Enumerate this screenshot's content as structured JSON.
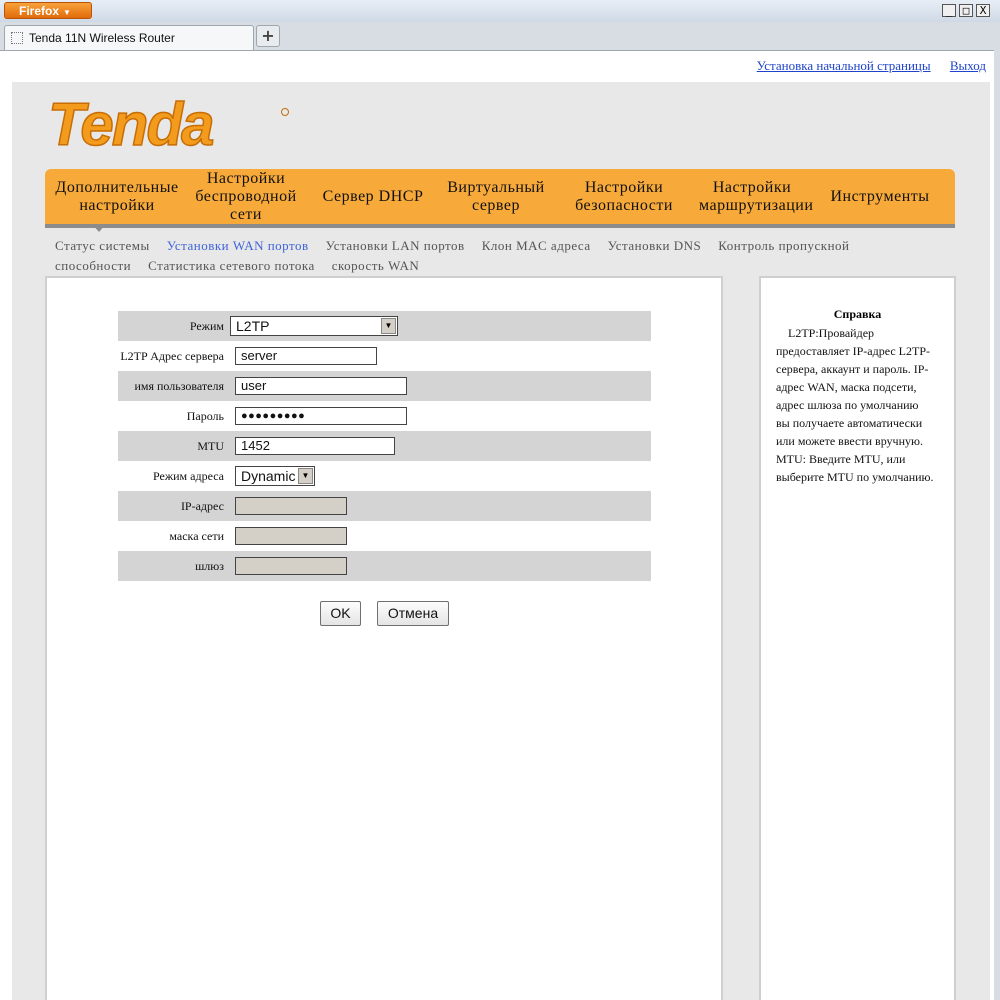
{
  "browser": {
    "menu_label": "Firefox",
    "tab_title": "Tenda 11N Wireless Router",
    "new_tab_label": "+",
    "window_controls": [
      "_",
      "□",
      "X"
    ]
  },
  "top_links": {
    "home_setup": "Установка начальной страницы",
    "logout": "Выход"
  },
  "logo": {
    "text": "Tenda",
    "color": "#f29b1c"
  },
  "main_nav": [
    "Дополнительные настройки",
    "Настройки беспроводной сети",
    "Сервер DHCP",
    "Виртуальный сервер",
    "Настройки безопасности",
    "Настройки маршрутизации",
    "Инструменты"
  ],
  "sub_nav": {
    "items": [
      "Статус системы",
      "Установки WAN портов",
      "Установки LAN портов",
      "Клон MAC адреса",
      "Установки DNS",
      "Контроль пропускной способности",
      "Статистика сетевого потока",
      "скорость WAN"
    ],
    "active": "Установки WAN портов"
  },
  "form": {
    "mode": {
      "label": "Режим",
      "value": "L2TP"
    },
    "server": {
      "label": "L2TP Адрес сервера",
      "value": "server"
    },
    "username": {
      "label": "имя пользователя",
      "value": "user"
    },
    "password": {
      "label": "Пароль",
      "value": "●●●●●●●●●"
    },
    "mtu": {
      "label": "MTU",
      "value": "1452"
    },
    "address_mode": {
      "label": "Режим адреса",
      "value": "Dynamic"
    },
    "ip": {
      "label": "IP-адрес",
      "value": ""
    },
    "mask": {
      "label": "маска сети",
      "value": ""
    },
    "gateway": {
      "label": "шлюз",
      "value": ""
    }
  },
  "buttons": {
    "ok": "OK",
    "cancel": "Отмена"
  },
  "help": {
    "title": "Справка",
    "text": "L2TP:Провайдер предоставляет IP-адрес L2TP-сервера, аккаунт и пароль. IP-адрес WAN, маска подсети, адрес шлюза по умолчанию вы получаете автоматически или можете ввести вручную. MTU: Введите MTU, или выберите MTU по умолчанию."
  },
  "colors": {
    "nav_bg": "#f7a93a",
    "active_link": "#3f63d9",
    "row_shade": "#d4d4d4"
  }
}
